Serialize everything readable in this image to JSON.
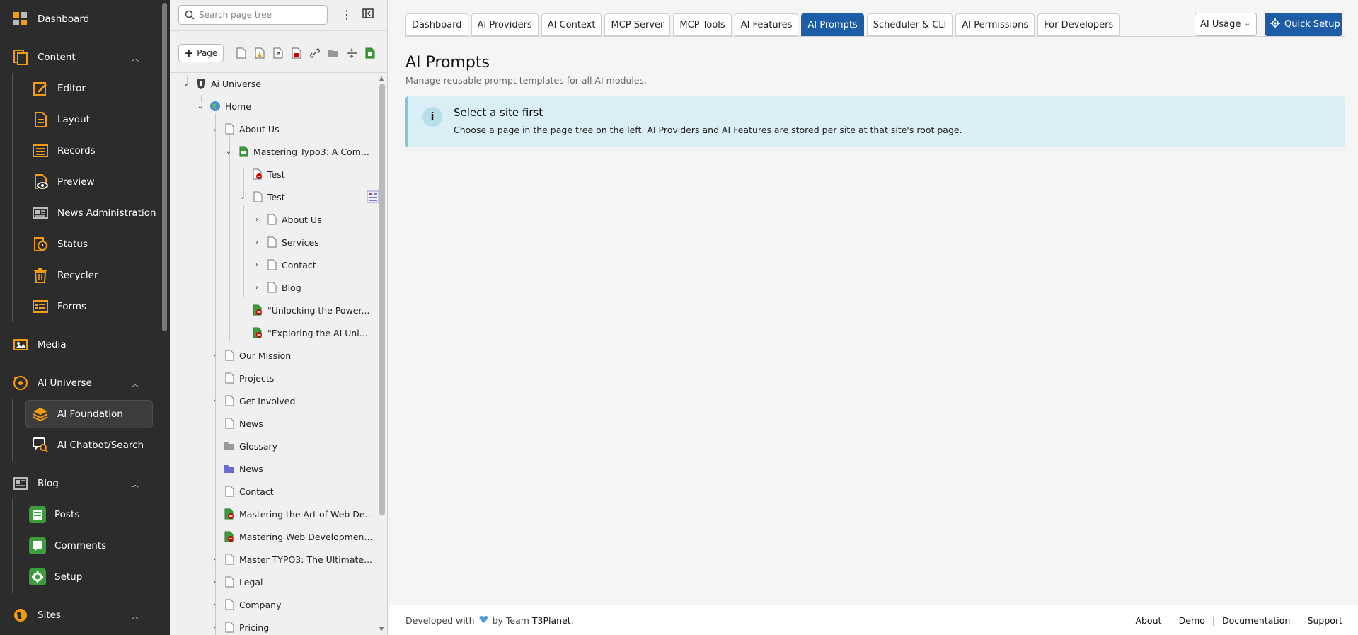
{
  "modules": {
    "dashboard": "Dashboard",
    "content": "Content",
    "content_items": [
      "Editor",
      "Layout",
      "Records",
      "Preview",
      "News Administration",
      "Status",
      "Recycler",
      "Forms"
    ],
    "media": "Media",
    "ai_universe": "AI Universe",
    "ai_items": [
      "AI Foundation",
      "AI Chatbot/Search"
    ],
    "blog": "Blog",
    "blog_items": [
      "Posts",
      "Comments",
      "Setup"
    ],
    "sites": "Sites"
  },
  "tree": {
    "search_placeholder": "Search page tree",
    "new_page_label": "Page",
    "nodes": [
      "Ai Universe",
      "Home",
      "About Us",
      "Mastering Typo3: A Com...",
      "Test",
      "Test",
      "About Us",
      "Services",
      "Contact",
      "Blog",
      "\"Unlocking the Power...",
      "\"Exploring the AI Uni...",
      "Our Mission",
      "Projects",
      "Get Involved",
      "News",
      "Glossary",
      "News",
      "Contact",
      "Mastering the Art of Web De...",
      "Mastering Web Developmen...",
      "Master TYPO3: The Ultimate...",
      "Legal",
      "Company",
      "Pricing"
    ]
  },
  "tabs": [
    "Dashboard",
    "AI Providers",
    "AI Context",
    "MCP Server",
    "MCP Tools",
    "AI Features",
    "AI Prompts",
    "Scheduler & CLI",
    "AI Permissions",
    "For Developers"
  ],
  "active_tab": "AI Prompts",
  "ai_usage_label": "AI Usage",
  "quick_setup_label": "Quick Setup",
  "page": {
    "title": "AI Prompts",
    "subtitle": "Manage reusable prompt templates for all AI modules."
  },
  "alert": {
    "title": "Select a site first",
    "body": "Choose a page in the page tree on the left. AI Providers and AI Features are stored per site at that site's root page."
  },
  "footer": {
    "developed_with": "Developed with",
    "by_team": "by Team",
    "brand": "T3Planet.",
    "links": [
      "About",
      "Demo",
      "Documentation",
      "Support"
    ]
  },
  "colors": {
    "sidebar_bg": "#2c2c2c",
    "accent_blue": "#1d5da8",
    "info_bg": "#d9eff5",
    "green": "#3c9d3c",
    "orange": "#f39c12"
  }
}
